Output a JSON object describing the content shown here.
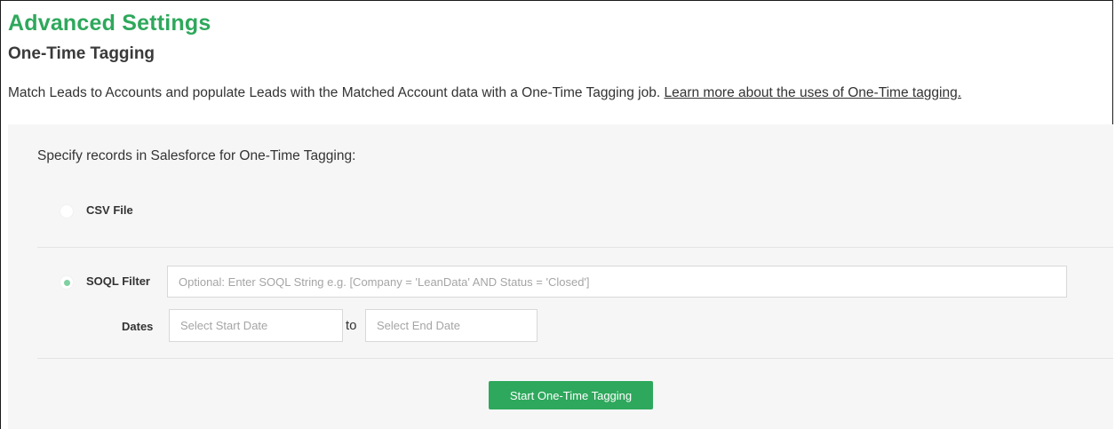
{
  "header": {
    "title": "Advanced Settings",
    "subtitle": "One-Time Tagging"
  },
  "description": {
    "text": "Match Leads to Accounts and populate Leads with the Matched Account data with a One-Time Tagging job.",
    "link_text": "Learn more about the uses of One-Time tagging."
  },
  "panel": {
    "heading": "Specify records in Salesforce for One-Time Tagging:",
    "options": {
      "csv": {
        "label": "CSV File",
        "selected": false
      },
      "soql": {
        "label": "SOQL Filter",
        "selected": true,
        "placeholder": "Optional: Enter SOQL String e.g. [Company = 'LeanData' AND Status = 'Closed']",
        "value": ""
      }
    },
    "dates": {
      "label": "Dates",
      "start_placeholder": "Select Start Date",
      "separator": "to",
      "end_placeholder": "Select End Date"
    },
    "start_button_label": "Start One-Time Tagging"
  },
  "colors": {
    "accent": "#2ea85c",
    "radio_selected": "#7fd1a1",
    "panel_background": "#f6f6f6"
  }
}
